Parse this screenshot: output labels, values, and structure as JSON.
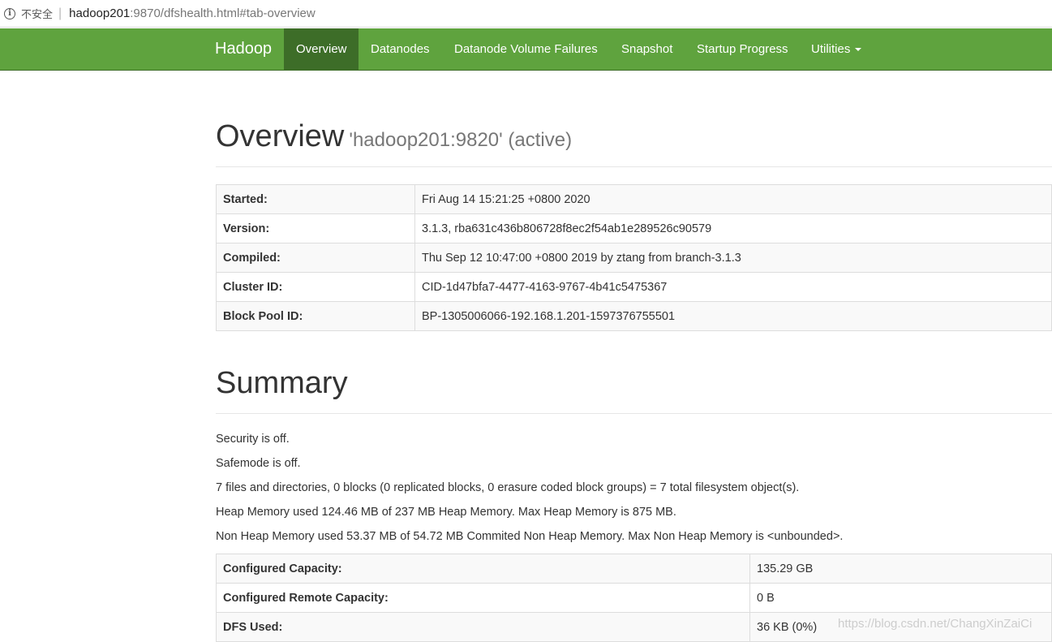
{
  "browser": {
    "security_label": "不安全",
    "separator": "|",
    "url_host": "hadoop201",
    "url_path": ":9870/dfshealth.html#tab-overview"
  },
  "nav": {
    "brand": "Hadoop",
    "items": [
      {
        "label": "Overview",
        "active": true
      },
      {
        "label": "Datanodes"
      },
      {
        "label": "Datanode Volume Failures"
      },
      {
        "label": "Snapshot"
      },
      {
        "label": "Startup Progress"
      },
      {
        "label": "Utilities"
      }
    ]
  },
  "overview": {
    "title": "Overview",
    "subtitle": "'hadoop201:9820' (active)",
    "rows": [
      {
        "key": "Started:",
        "value": "Fri Aug 14 15:21:25 +0800 2020"
      },
      {
        "key": "Version:",
        "value": "3.1.3, rba631c436b806728f8ec2f54ab1e289526c90579"
      },
      {
        "key": "Compiled:",
        "value": "Thu Sep 12 10:47:00 +0800 2019 by ztang from branch-3.1.3"
      },
      {
        "key": "Cluster ID:",
        "value": "CID-1d47bfa7-4477-4163-9767-4b41c5475367"
      },
      {
        "key": "Block Pool ID:",
        "value": "BP-1305006066-192.168.1.201-1597376755501"
      }
    ]
  },
  "summary": {
    "title": "Summary",
    "lines": [
      "Security is off.",
      "Safemode is off.",
      "7 files and directories, 0 blocks (0 replicated blocks, 0 erasure coded block groups) = 7 total filesystem object(s).",
      "Heap Memory used 124.46 MB of 237 MB Heap Memory. Max Heap Memory is 875 MB.",
      "Non Heap Memory used 53.37 MB of 54.72 MB Commited Non Heap Memory. Max Non Heap Memory is <unbounded>."
    ],
    "rows": [
      {
        "key": "Configured Capacity:",
        "value": "135.29 GB"
      },
      {
        "key": "Configured Remote Capacity:",
        "value": "0 B"
      },
      {
        "key": "DFS Used:",
        "value": "36 KB (0%)"
      }
    ]
  },
  "watermark": "https://blog.csdn.net/ChangXinZaiCi"
}
